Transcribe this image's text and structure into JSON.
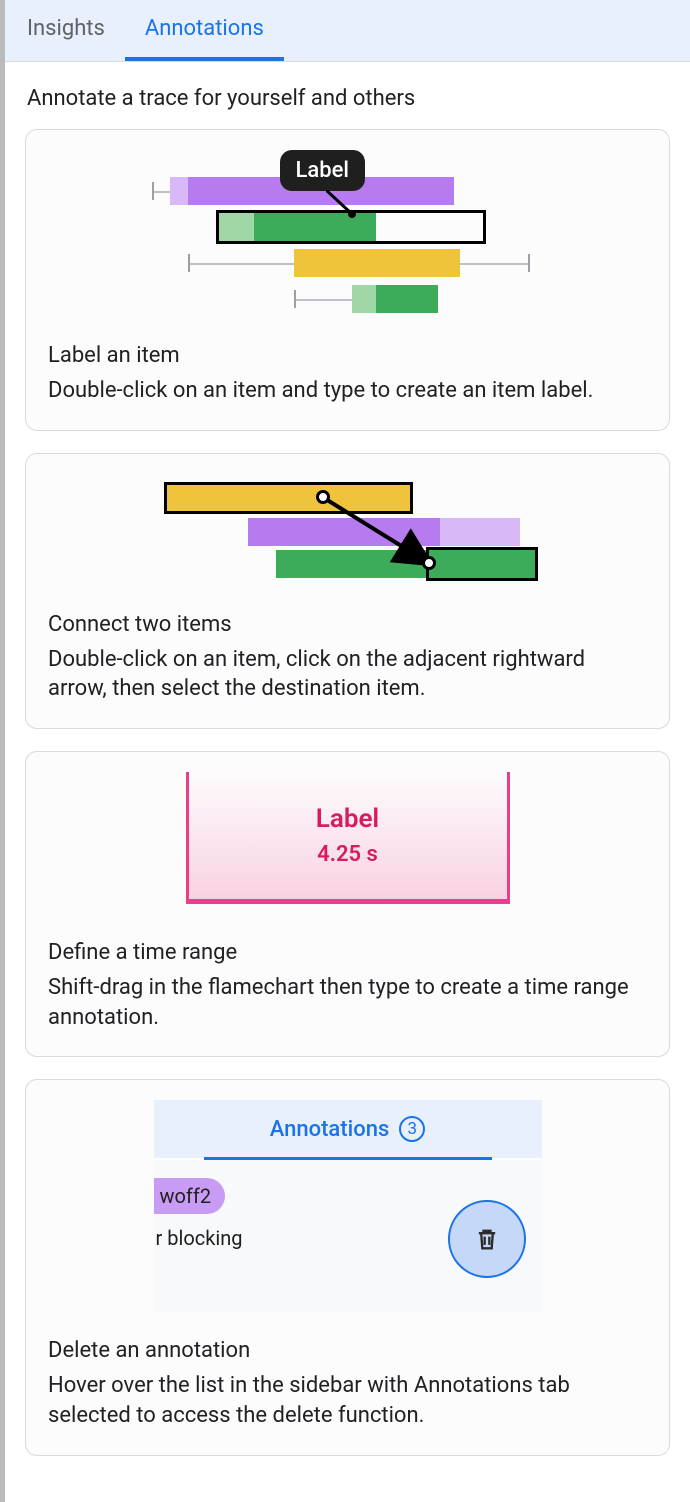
{
  "tabs": {
    "insights": "Insights",
    "annotations": "Annotations"
  },
  "page_title": "Annotate a trace for yourself and others",
  "cards": {
    "label": {
      "title": "Label an item",
      "desc": "Double-click on an item and type to create an item label.",
      "chip_text": "Label"
    },
    "connect": {
      "title": "Connect two items",
      "desc": "Double-click on an item, click on the adjacent rightward arrow, then select the destination item."
    },
    "range": {
      "title": "Define a time range",
      "desc": "Shift-drag in the flamechart then type to create a time range annotation.",
      "label_text": "Label",
      "time_text": "4.25 s"
    },
    "delete": {
      "title": "Delete an annotation",
      "desc": "Hover over the list in the sidebar with Annotations tab selected to access the delete function.",
      "tab_label": "Annotations",
      "badge": "3",
      "pill": "woff2",
      "row_text": "r blocking"
    }
  },
  "colors": {
    "purple": "#b77bf0",
    "purple_light": "#d9b8f7",
    "green": "#3cab5a",
    "green_light": "#9fd7a7",
    "yellow": "#efc33b",
    "pink": "#e83e8c",
    "blue": "#1a73e8"
  }
}
